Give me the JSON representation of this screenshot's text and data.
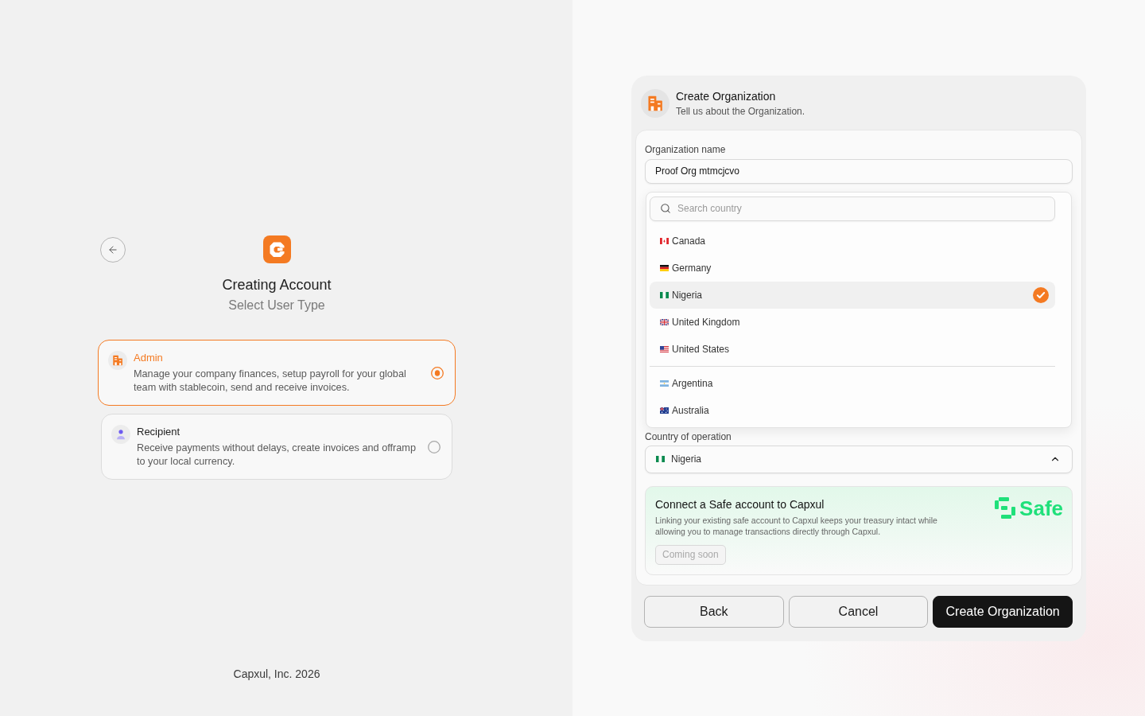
{
  "left_panel": {
    "title": "Creating Account",
    "subtitle": "Select User Type",
    "user_types": [
      {
        "kind": "admin",
        "title": "Admin",
        "description": "Manage your company finances, setup payroll for your global team with stablecoin, send and receive invoices.",
        "selected": true
      },
      {
        "kind": "recipient",
        "title": "Recipient",
        "description": "Receive payments without delays, create invoices and offramp to your local currency.",
        "selected": false
      }
    ],
    "footer": "Capxul, Inc. 2026"
  },
  "dialog": {
    "title": "Create Organization",
    "subtitle": "Tell us about the Organization.",
    "org_name": {
      "label": "Organization name",
      "value": "Proof Org mtmcjcvo"
    },
    "country_select": {
      "label": "Country of operation",
      "value": {
        "kind": "ng",
        "label": "Nigeria"
      },
      "expanded": true,
      "search_placeholder": "Search country",
      "groups": [
        {
          "items": [
            {
              "kind": "ca",
              "label": "Canada",
              "selected": false
            },
            {
              "kind": "de",
              "label": "Germany",
              "selected": false
            },
            {
              "kind": "ng",
              "label": "Nigeria",
              "selected": true
            },
            {
              "kind": "gb",
              "label": "United Kingdom",
              "selected": false
            },
            {
              "kind": "us",
              "label": "United States",
              "selected": false
            }
          ]
        },
        {
          "items": [
            {
              "kind": "ar",
              "label": "Argentina",
              "selected": false
            },
            {
              "kind": "au",
              "label": "Australia",
              "selected": false
            }
          ]
        }
      ]
    },
    "safe_card": {
      "title": "Connect a Safe account to Capxul",
      "description": "Linking your existing safe account to Capxul keeps your treasury intact while allowing you to manage transactions directly through Capxul.",
      "logo_text": "Safe",
      "button": {
        "label": "Coming soon",
        "disabled": true
      }
    },
    "buttons": [
      {
        "kind": "back",
        "label": "Back"
      },
      {
        "kind": "cancel",
        "label": "Cancel"
      },
      {
        "kind": "submit",
        "label": "Create Organization"
      }
    ]
  }
}
